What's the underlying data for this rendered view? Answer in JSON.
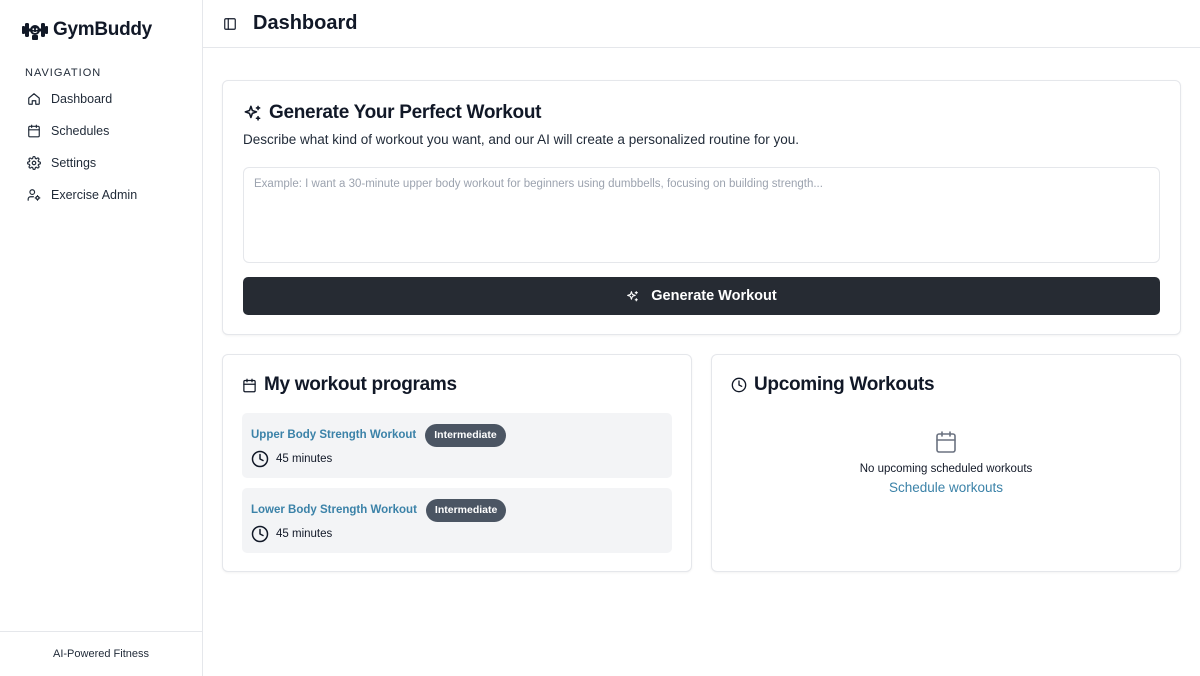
{
  "brand": {
    "name": "GymBuddy"
  },
  "sidebar": {
    "heading": "Navigation",
    "items": [
      {
        "label": "Dashboard",
        "icon": "home-icon"
      },
      {
        "label": "Schedules",
        "icon": "calendar-icon"
      },
      {
        "label": "Settings",
        "icon": "gear-icon"
      },
      {
        "label": "Exercise Admin",
        "icon": "user-cog-icon"
      }
    ],
    "footer": "AI-Powered Fitness"
  },
  "header": {
    "title": "Dashboard"
  },
  "generate": {
    "title": "Generate Your Perfect Workout",
    "description": "Describe what kind of workout you want, and our AI will create a personalized routine for you.",
    "placeholder": "Example: I want a 30-minute upper body workout for beginners using dumbbells, focusing on building strength...",
    "button_label": "Generate Workout"
  },
  "programs": {
    "title": "My workout programs",
    "items": [
      {
        "name": "Upper Body Strength Workout",
        "level": "Intermediate",
        "duration": "45 minutes"
      },
      {
        "name": "Lower Body Strength Workout",
        "level": "Intermediate",
        "duration": "45 minutes"
      }
    ]
  },
  "upcoming": {
    "title": "Upcoming Workouts",
    "empty_text": "No upcoming scheduled workouts",
    "link_label": "Schedule workouts"
  },
  "colors": {
    "primary_button": "#262b33",
    "link": "#3b82a8",
    "badge": "#4b5563",
    "program_bg": "#f3f4f6",
    "border": "#e5e7eb"
  }
}
